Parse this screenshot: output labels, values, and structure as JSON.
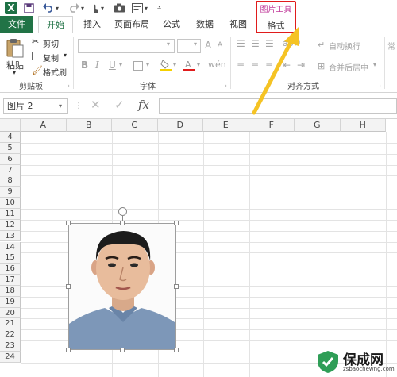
{
  "qat": {
    "logo": "X",
    "icons": [
      "excel-logo",
      "save-icon",
      "undo-icon",
      "redo-icon",
      "touch-mode-icon",
      "camera-icon",
      "print-preview-icon",
      "customize-icon"
    ]
  },
  "tabs": {
    "file": "文件",
    "home": "开始",
    "insert": "插入",
    "page_layout": "页面布局",
    "formulas": "公式",
    "data": "数据",
    "view": "视图",
    "context_title": "图片工具",
    "context_tab": "格式"
  },
  "ribbon": {
    "clipboard": {
      "paste": "粘贴",
      "cut": "剪切",
      "copy": "复制",
      "format_painter": "格式刷",
      "label": "剪贴板"
    },
    "font": {
      "label": "字体",
      "bold": "B",
      "italic": "I",
      "underline": "U",
      "grow": "A",
      "shrink": "A"
    },
    "alignment": {
      "label": "对齐方式",
      "wrap_text": "自动换行",
      "merge_center": "合并后居中",
      "number_peek": "常"
    }
  },
  "formula_bar": {
    "name_box": "图片 2",
    "fx": "fx"
  },
  "grid": {
    "columns": [
      "A",
      "B",
      "C",
      "D",
      "E",
      "F",
      "G",
      "H"
    ],
    "rows": [
      "4",
      "5",
      "6",
      "7",
      "8",
      "9",
      "10",
      "11",
      "12",
      "13",
      "14",
      "15",
      "16",
      "17",
      "18",
      "19",
      "20",
      "21",
      "22",
      "23",
      "24"
    ]
  },
  "watermark": {
    "main": "保成网",
    "url": "zsbaochewng.com"
  },
  "colors": {
    "excel_green": "#217346",
    "context_pink": "#c0399a",
    "highlight_red": "#e01c1c",
    "arrow_yellow": "#f5c324"
  }
}
